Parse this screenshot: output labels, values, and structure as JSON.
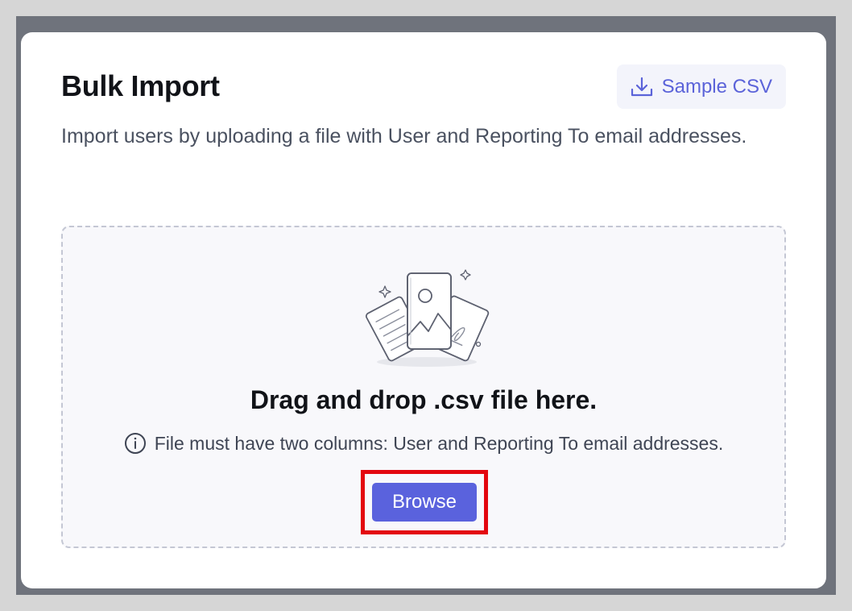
{
  "modal": {
    "title": "Bulk Import",
    "sample_button_label": "Sample CSV",
    "description": "Import users by uploading a file with User and Reporting To email addresses."
  },
  "dropzone": {
    "illustration_icon": "documents-upload-illustration",
    "heading": "Drag and drop .csv file here.",
    "hint_icon": "info-icon",
    "hint_text": "File must have two columns: User and Reporting To email addresses.",
    "browse_label": "Browse"
  },
  "colors": {
    "accent": "#5a62dd",
    "highlight_border": "#e3070f",
    "sample_button_bg": "#f3f4fb",
    "dropzone_bg": "#f8f8fb"
  }
}
